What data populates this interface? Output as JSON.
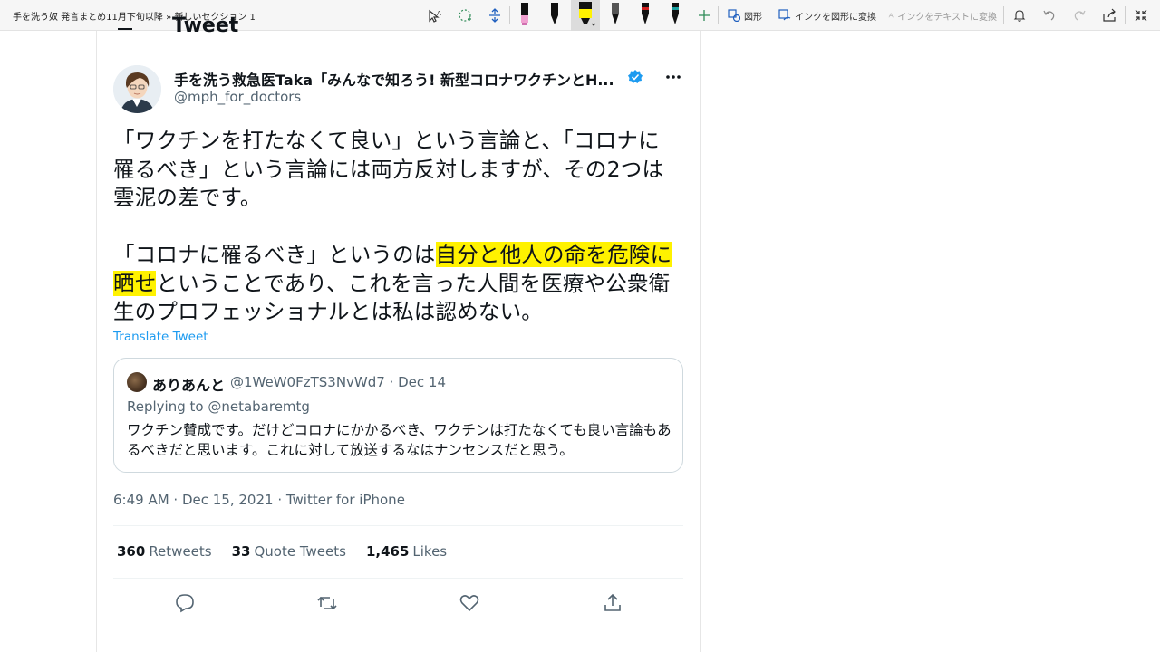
{
  "toolbar": {
    "breadcrumb": "手を洗う奴 発言まとめ11月下旬以降 » 新しいセクション 1",
    "shapes_label": "図形",
    "ink_to_shape_label": "インクを図形に変換",
    "ink_to_text_label": "インクをテキストに変換"
  },
  "tweet": {
    "header_title": "Tweet",
    "author_name": "手を洗う救急医Taka「みんなで知ろう! 新型コロナワクチンとH...",
    "handle": "@mph_for_doctors",
    "para1": "「ワクチンを打たなくて良い」という言論と、「コロナに罹るべき」という言論には両方反対しますが、その2つは雲泥の差です。",
    "para2_before": "「コロナに罹るべき」というのは",
    "para2_highlight": "自分と他人の命を危険に晒せ",
    "para2_after": "ということであり、これを言った人間を医療や公衆衛生のプロフェッショナルとは私は認めない。",
    "translate": "Translate Tweet",
    "timestamp": "6:49 AM · Dec 15, 2021 · Twitter for iPhone"
  },
  "quote": {
    "name": "ありあんと",
    "meta": "@1WeW0FzTS3NvWd7 · Dec 14",
    "replying": "Replying to @netabaremtg",
    "text": "ワクチン賛成です。だけどコロナにかかるべき、ワクチンは打たなくても良い言論もあるべきだと思います。これに対して放送するなはナンセンスだと思う。"
  },
  "stats": {
    "retweets_count": "360",
    "retweets_label": "Retweets",
    "quotes_count": "33",
    "quotes_label": "Quote Tweets",
    "likes_count": "1,465",
    "likes_label": "Likes"
  },
  "colors": {
    "highlight": "#fff200",
    "link": "#1d9bf0",
    "verified": "#1d9bf0",
    "secondary_text": "#536471"
  }
}
